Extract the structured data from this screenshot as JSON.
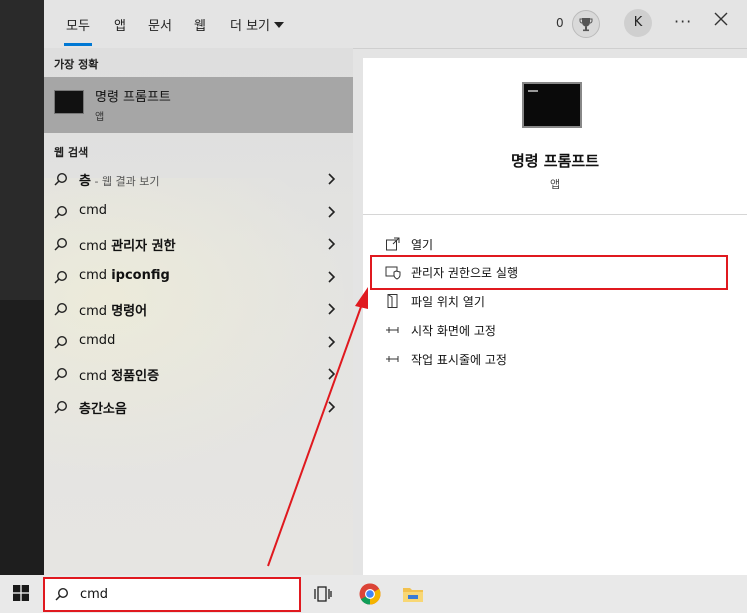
{
  "tabs": [
    {
      "label": "모두",
      "active": true
    },
    {
      "label": "앱"
    },
    {
      "label": "문서"
    },
    {
      "label": "웹"
    },
    {
      "label": "더 보기"
    }
  ],
  "header": {
    "reward_count": "0",
    "avatar_initial": "K",
    "more_label": "···"
  },
  "sections": {
    "best_match": "가장 정확",
    "web_search": "웹 검색"
  },
  "best_match": {
    "title": "명령 프롬프트",
    "subtitle": "앱"
  },
  "web_results": [
    {
      "bold": "층",
      "suffix": " - 웹 결과 보기",
      "plain": ""
    },
    {
      "plain": "cmd"
    },
    {
      "plain": "cmd ",
      "bold": "관리자 권한"
    },
    {
      "plain": "cmd ",
      "bold": "ipconfig"
    },
    {
      "plain": "cmd ",
      "bold": "명령어"
    },
    {
      "plain": "cmdd"
    },
    {
      "plain": "cmd ",
      "bold": "정품인증"
    },
    {
      "bold": "층간소음"
    }
  ],
  "details": {
    "title": "명령 프롬프트",
    "subtitle": "앱",
    "actions": [
      {
        "label": "열기",
        "icon": "open-icon"
      },
      {
        "label": "관리자 권한으로 실행",
        "icon": "shield-icon"
      },
      {
        "label": "파일 위치 열기",
        "icon": "file-location-icon"
      },
      {
        "label": "시작 화면에 고정",
        "icon": "pin-icon"
      },
      {
        "label": "작업 표시줄에 고정",
        "icon": "pin-icon"
      }
    ]
  },
  "search": {
    "value": "cmd"
  },
  "colors": {
    "accent": "#0078d4",
    "highlight": "#e0191f",
    "best_match_bg": "#a6a6a6"
  }
}
